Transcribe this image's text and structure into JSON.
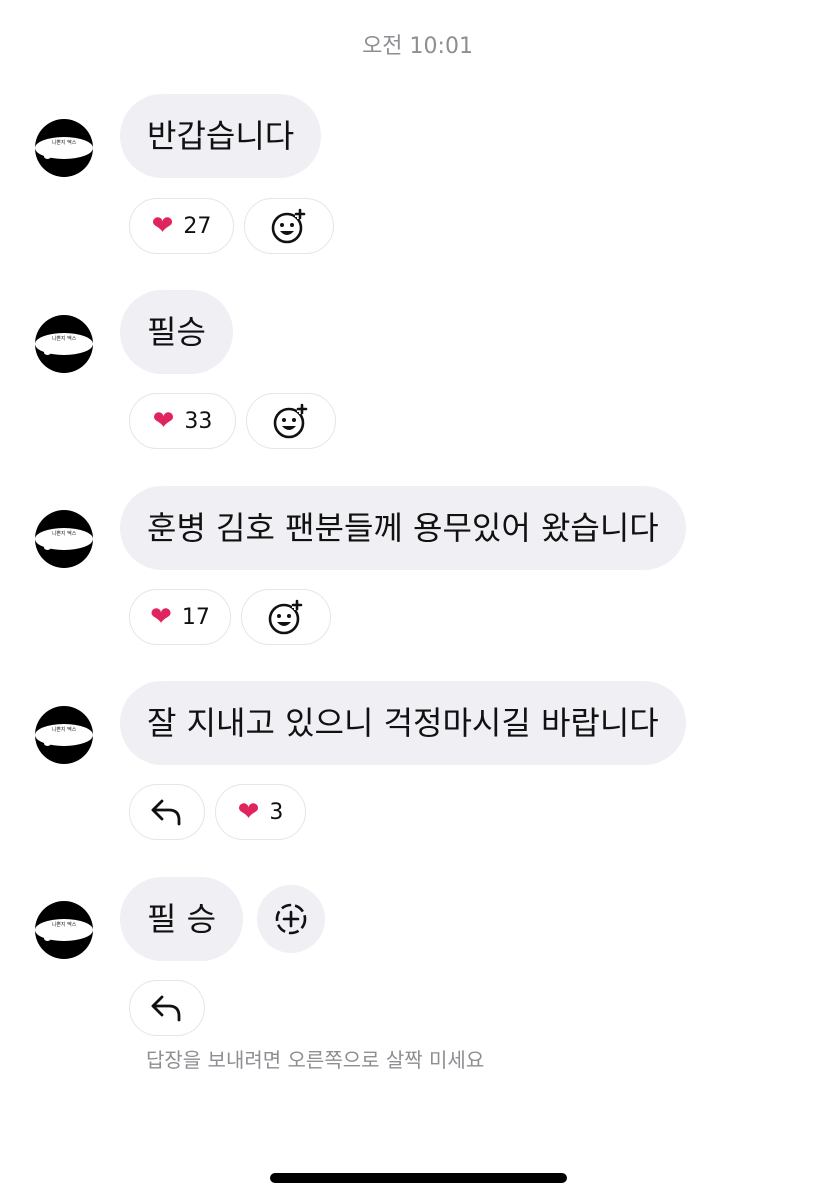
{
  "timestamp": "오전 10:01",
  "messages": [
    {
      "text": "반갑습니다",
      "reactions": {
        "heart_count": "27"
      }
    },
    {
      "text": "필승",
      "reactions": {
        "heart_count": "33"
      }
    },
    {
      "text": "훈병 김호 팬분들께 용무있어 왔습니다",
      "reactions": {
        "heart_count": "17"
      }
    },
    {
      "text": "잘 지내고 있으니 걱정마시길 바랍니다",
      "reactions": {
        "heart_count": "3"
      }
    },
    {
      "text": "필 승"
    }
  ],
  "avatar_label": "니쁜지 멕스",
  "swipe_hint": "답장을 보내려면 오른쪽으로 살짝 미세요",
  "icons": {
    "heart": "red-heart-emoji",
    "add_reaction": "smiley-plus-icon",
    "reply": "reply-arrow-icon",
    "dashed_add": "dashed-circle-plus-icon"
  },
  "colors": {
    "bubble": "#efeff4",
    "heart": "#e0245e",
    "secondary_text": "#8e8e93"
  }
}
